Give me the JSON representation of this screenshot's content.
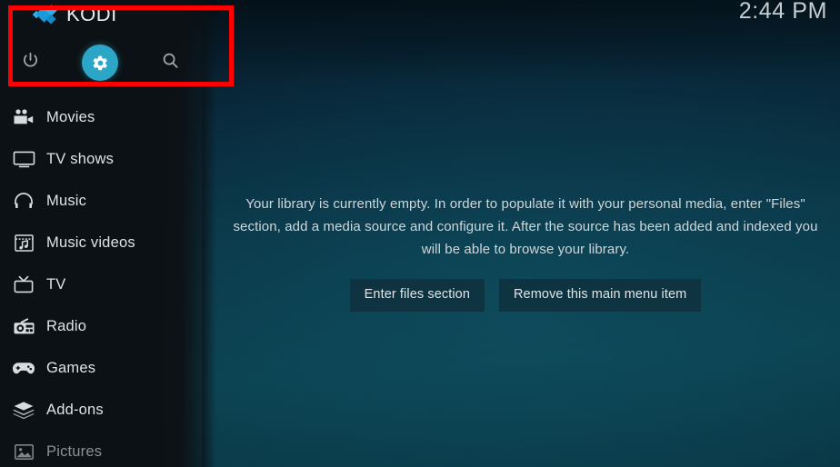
{
  "app": {
    "name": "KODI",
    "logo_icon": "kodi-logo-icon"
  },
  "clock": {
    "time": "2:44 PM"
  },
  "header_controls": [
    {
      "id": "power",
      "icon": "power-icon",
      "label": "Power",
      "selected": false
    },
    {
      "id": "settings",
      "icon": "gear-icon",
      "label": "Settings",
      "selected": true
    },
    {
      "id": "search",
      "icon": "search-icon",
      "label": "Search",
      "selected": false
    }
  ],
  "annotation": {
    "type": "highlight-rectangle",
    "color": "#fe0000",
    "target": "header-controls-region"
  },
  "sidebar": {
    "items": [
      {
        "label": "Movies",
        "icon": "movie-camera-icon",
        "dim": false
      },
      {
        "label": "TV shows",
        "icon": "television-icon",
        "dim": false
      },
      {
        "label": "Music",
        "icon": "headphones-icon",
        "dim": false
      },
      {
        "label": "Music videos",
        "icon": "music-video-icon",
        "dim": false
      },
      {
        "label": "TV",
        "icon": "tv-antenna-icon",
        "dim": false
      },
      {
        "label": "Radio",
        "icon": "radio-icon",
        "dim": false
      },
      {
        "label": "Games",
        "icon": "gamepad-icon",
        "dim": false
      },
      {
        "label": "Add-ons",
        "icon": "addons-box-icon",
        "dim": false
      },
      {
        "label": "Pictures",
        "icon": "pictures-icon",
        "dim": true
      }
    ]
  },
  "main": {
    "empty_message": "Your library is currently empty. In order to populate it with your personal media, enter \"Files\" section, add a media source and configure it. After the source has been added and indexed you will be able to browse your library.",
    "buttons": [
      {
        "label": "Enter files section"
      },
      {
        "label": "Remove this main menu item"
      }
    ]
  },
  "colors": {
    "accent": "#2ba6c6",
    "logo_blue": "#22a3e0",
    "annotation_red": "#fe0000",
    "sidebar_bg": "#0c1115",
    "background_teal": "#0b3f4d"
  }
}
